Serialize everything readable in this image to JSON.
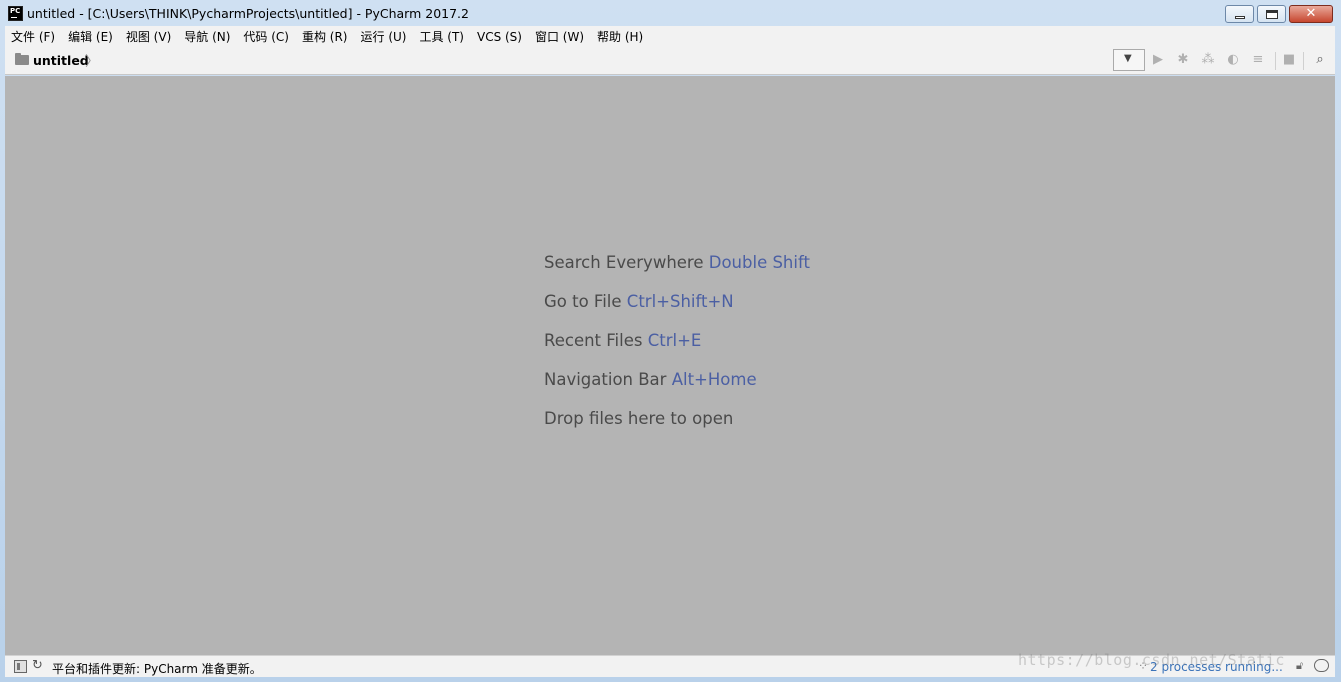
{
  "window": {
    "title": "untitled - [C:\\Users\\THINK\\PycharmProjects\\untitled] - PyCharm 2017.2",
    "app_icon_text": "PC"
  },
  "menu": {
    "items": [
      {
        "label": "文件 (F)"
      },
      {
        "label": "编辑 (E)"
      },
      {
        "label": "视图 (V)"
      },
      {
        "label": "导航 (N)"
      },
      {
        "label": "代码 (C)"
      },
      {
        "label": "重构 (R)"
      },
      {
        "label": "运行 (U)"
      },
      {
        "label": "工具 (T)"
      },
      {
        "label": "VCS (S)"
      },
      {
        "label": "窗口 (W)"
      },
      {
        "label": "帮助 (H)"
      }
    ]
  },
  "navbar": {
    "breadcrumb": "untitled"
  },
  "editor": {
    "hints": [
      {
        "text": "Search Everywhere",
        "key": "Double Shift"
      },
      {
        "text": "Go to File",
        "key": "Ctrl+Shift+N"
      },
      {
        "text": "Recent Files",
        "key": "Ctrl+E"
      },
      {
        "text": "Navigation Bar",
        "key": "Alt+Home"
      },
      {
        "text": "Drop files here to open",
        "key": ""
      }
    ]
  },
  "status": {
    "message": "平台和插件更新: PyCharm 准备更新。",
    "processes": "2 processes running..."
  },
  "watermark": "https://blog.csdn.net/Static"
}
